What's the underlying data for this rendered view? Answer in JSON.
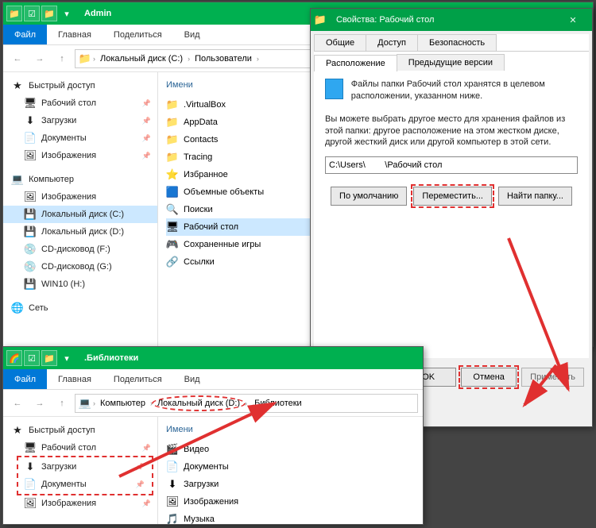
{
  "win1": {
    "title": "Admin",
    "menu": {
      "file": "Файл",
      "home": "Главная",
      "share": "Поделиться",
      "view": "Вид"
    },
    "crumbs": [
      "Локальный диск (C:)",
      "Пользователи"
    ],
    "sidebar": {
      "quick": "Быстрый доступ",
      "items": [
        "Рабочий стол",
        "Загрузки",
        "Документы",
        "Изображения"
      ],
      "computer": "Компьютер",
      "comp_items": [
        "Изображения",
        "Локальный диск (C:)",
        "Локальный диск (D:)",
        "CD-дисковод (F:)",
        "CD-дисковод (G:)",
        "WIN10 (H:)"
      ],
      "network": "Сеть"
    },
    "content": {
      "hdr": "Имени",
      "items": [
        ".VirtualBox",
        "AppData",
        "Contacts",
        "Tracing",
        "Избранное",
        "Объемные объекты",
        "Поиски",
        "Рабочий стол",
        "Сохраненные игры",
        "Ссылки"
      ]
    }
  },
  "dlg": {
    "title": "Свойства: Рабочий стол",
    "tabs": [
      "Общие",
      "Доступ",
      "Безопасность"
    ],
    "tabs2": [
      "Расположение",
      "Предыдущие версии"
    ],
    "text1": "Файлы папки Рабочий стол хранятся в целевом расположении, указанном ниже.",
    "text2": "Вы можете выбрать другое место для хранения файлов из этой папки: другое расположение на этом жестком диске, другой жесткий диск или другой компьютер в этой сети.",
    "path": "C:\\Users\\        \\Рабочий стол",
    "btn_default": "По умолчанию",
    "btn_move": "Переместить...",
    "btn_find": "Найти папку...",
    "ok": "OK",
    "cancel": "Отмена",
    "apply": "Применить"
  },
  "win2": {
    "title": ".Библиотеки",
    "menu": {
      "file": "Файл",
      "home": "Главная",
      "share": "Поделиться",
      "view": "Вид"
    },
    "crumbs": [
      "Компьютер",
      "Локальный диск (D:)",
      ".Библиотеки"
    ],
    "sidebar": {
      "quick": "Быстрый доступ",
      "items": [
        "Рабочий стол",
        "Загрузки",
        "Документы",
        "Изображения"
      ]
    },
    "content": {
      "hdr": "Имени",
      "items": [
        "Видео",
        "Документы",
        "Загрузки",
        "Изображения",
        "Музыка"
      ]
    }
  }
}
